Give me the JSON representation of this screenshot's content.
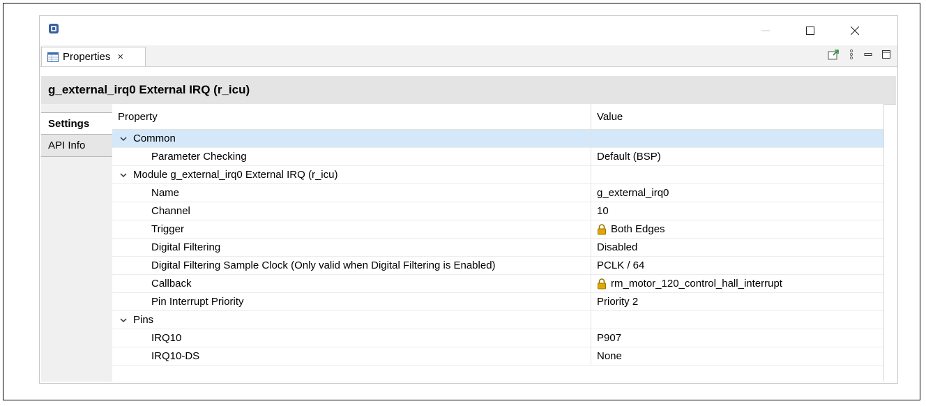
{
  "window": {
    "icon": "renesas-chip-icon",
    "controls": [
      "minimize-icon",
      "maximize-icon",
      "close-icon"
    ]
  },
  "tab": {
    "label": "Properties",
    "icon": "properties-table-icon",
    "close_glyph": "×"
  },
  "toolbar": {
    "icons": [
      "pin-to-editor-icon",
      "view-menu-icon",
      "minimize-view-icon",
      "maximize-view-icon"
    ]
  },
  "panel": {
    "title": "g_external_irq0 External IRQ (r_icu)"
  },
  "side_tabs": [
    {
      "label": "Settings",
      "active": true
    },
    {
      "label": "API Info",
      "active": false
    }
  ],
  "grid": {
    "columns": [
      "Property",
      "Value"
    ],
    "rows": [
      {
        "label": "Common",
        "value": "",
        "level": 0,
        "group": true,
        "selected": true,
        "locked": false
      },
      {
        "label": "Parameter Checking",
        "value": "Default (BSP)",
        "level": 1,
        "group": false,
        "selected": false,
        "locked": false
      },
      {
        "label": "Module g_external_irq0 External IRQ (r_icu)",
        "value": "",
        "level": 0,
        "group": true,
        "selected": false,
        "locked": false
      },
      {
        "label": "Name",
        "value": "g_external_irq0",
        "level": 1,
        "group": false,
        "selected": false,
        "locked": false
      },
      {
        "label": "Channel",
        "value": "10",
        "level": 1,
        "group": false,
        "selected": false,
        "locked": false
      },
      {
        "label": "Trigger",
        "value": "Both Edges",
        "level": 1,
        "group": false,
        "selected": false,
        "locked": true
      },
      {
        "label": "Digital Filtering",
        "value": "Disabled",
        "level": 1,
        "group": false,
        "selected": false,
        "locked": false
      },
      {
        "label": "Digital Filtering Sample Clock (Only valid when Digital Filtering is Enabled)",
        "value": "PCLK / 64",
        "level": 1,
        "group": false,
        "selected": false,
        "locked": false
      },
      {
        "label": "Callback",
        "value": "rm_motor_120_control_hall_interrupt",
        "level": 1,
        "group": false,
        "selected": false,
        "locked": true
      },
      {
        "label": "Pin Interrupt Priority",
        "value": "Priority 2",
        "level": 1,
        "group": false,
        "selected": false,
        "locked": false
      },
      {
        "label": "Pins",
        "value": "",
        "level": 0,
        "group": true,
        "selected": false,
        "locked": false
      },
      {
        "label": "IRQ10",
        "value": "P907",
        "level": 1,
        "group": false,
        "selected": false,
        "locked": false
      },
      {
        "label": "IRQ10-DS",
        "value": "None",
        "level": 1,
        "group": false,
        "selected": false,
        "locked": false
      }
    ]
  },
  "colors": {
    "selection": "#d4e8fa",
    "header_bg": "#e4e4e4",
    "lock": "#e0a800"
  }
}
